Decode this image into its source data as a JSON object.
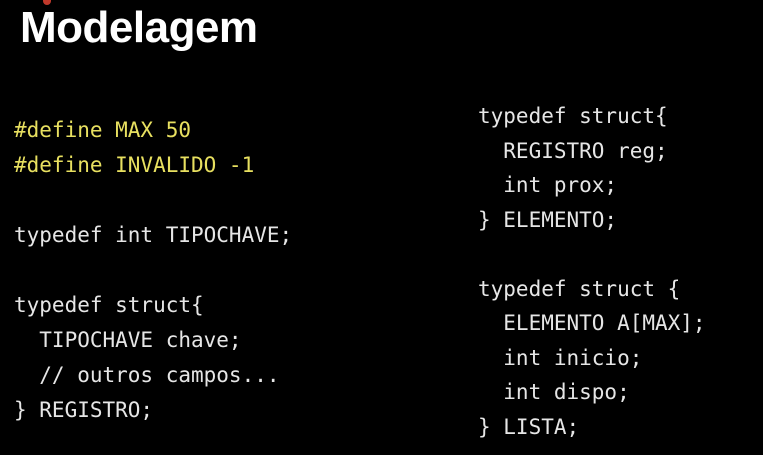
{
  "title": "Modelagem",
  "colors": {
    "background": "#000000",
    "title": "#ffffff",
    "code": "#e6e6e6",
    "preprocessor": "#e8e060"
  },
  "code_left": [
    {
      "text": "#define MAX 50",
      "kind": "preprocessor"
    },
    {
      "text": "#define INVALIDO -1",
      "kind": "preprocessor"
    },
    {
      "text": "",
      "kind": "blank"
    },
    {
      "text": "typedef int TIPOCHAVE;",
      "kind": "code"
    },
    {
      "text": "",
      "kind": "blank"
    },
    {
      "text": "typedef struct{",
      "kind": "code"
    },
    {
      "text": "  TIPOCHAVE chave;",
      "kind": "code"
    },
    {
      "text": "  // outros campos...",
      "kind": "code"
    },
    {
      "text": "} REGISTRO;",
      "kind": "code"
    }
  ],
  "code_right": [
    {
      "text": "typedef struct{",
      "kind": "code"
    },
    {
      "text": "  REGISTRO reg;",
      "kind": "code"
    },
    {
      "text": "  int prox;",
      "kind": "code"
    },
    {
      "text": "} ELEMENTO;",
      "kind": "code"
    },
    {
      "text": "",
      "kind": "blank"
    },
    {
      "text": "typedef struct {",
      "kind": "code"
    },
    {
      "text": "  ELEMENTO A[MAX];",
      "kind": "code"
    },
    {
      "text": "  int inicio;",
      "kind": "code"
    },
    {
      "text": "  int dispo;",
      "kind": "code"
    },
    {
      "text": "} LISTA;",
      "kind": "code"
    }
  ]
}
